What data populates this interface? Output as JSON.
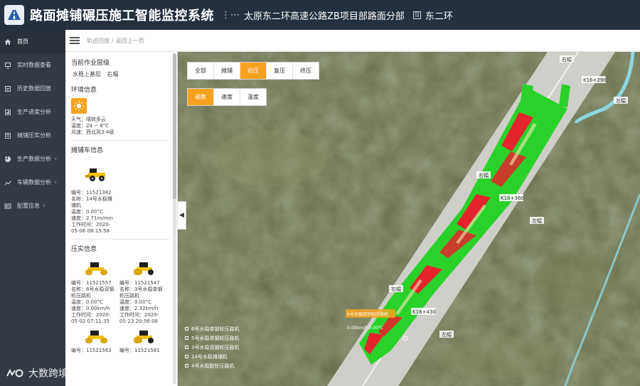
{
  "header": {
    "title": "路面摊铺碾压施工智能监控系统",
    "project": "太原东二环高速公路ZB项目部路面分部",
    "section": "东二环",
    "section_icon": "目"
  },
  "sidebar": {
    "items": [
      {
        "label": "首页",
        "icon": "home-icon"
      },
      {
        "label": "实时数据查看",
        "icon": "monitor-icon"
      },
      {
        "label": "历史数据回放",
        "icon": "history-icon"
      },
      {
        "label": "生产进度分析",
        "icon": "progress-icon"
      },
      {
        "label": "摊铺压实分析",
        "icon": "analysis-icon"
      },
      {
        "label": "生产数据分析",
        "icon": "pie-icon",
        "caret": "∨"
      },
      {
        "label": "车辆数据分析",
        "icon": "chart-icon",
        "caret": "∨"
      },
      {
        "label": "配置信息",
        "icon": "config-icon",
        "caret": "∨"
      }
    ]
  },
  "breadcrumb": {
    "first": "轨迹回放",
    "separator": "/",
    "second": "返回上一页"
  },
  "panel": {
    "layer": {
      "title": "当前作业层级",
      "name": "水稳上基层",
      "side": "右幅"
    },
    "env": {
      "title": "环境信息",
      "weather": "天气：晴转多云",
      "temperature": "温度：24 ~ 8°C",
      "wind": "风速：西北风3-4级"
    },
    "paver": {
      "title": "摊铺车信息",
      "lines": [
        "编号：11521382",
        "名称：14号水稳摊",
        "铺机",
        "温度：0.00°C",
        "速度：2.71m/min",
        "工作时间：2020-",
        "05-06 08:15:58"
      ]
    },
    "rollers": {
      "title": "压实信息",
      "items": [
        {
          "lines": [
            "编号：11521557",
            "名称：6号水稳双钢",
            "轮压路机",
            "温度：0.00°C",
            "速度：0.00km/h",
            "工作时间：2020-",
            "05-02 07:11:35"
          ]
        },
        {
          "lines": [
            "编号：11521547",
            "名称：3号水稳单钢",
            "轮压路机",
            "温度：0.00°C",
            "速度：2.32km/h",
            "工作时间：2020-",
            "05-23 20:56:08"
          ]
        },
        {
          "lines": [
            "编号：11521563"
          ]
        },
        {
          "lines": [
            "编号：11521581"
          ]
        }
      ]
    }
  },
  "map": {
    "mode_tabs": [
      "全部",
      "摊铺",
      "初压",
      "复压",
      "终压"
    ],
    "active_mode": 2,
    "metric_tabs": [
      "遍数",
      "速度",
      "温度"
    ],
    "active_metric": 0,
    "labels": {
      "stake1": "K16+290",
      "stake2": "K16+360",
      "stake3": "K16+430",
      "right": "右幅",
      "left": "左幅",
      "rl_top": "右幅",
      "ll_top": "左幅",
      "rl_mid": "右幅",
      "ll_mid": "左幅",
      "rl_low": "右幅",
      "ll_low": "左幅"
    },
    "machine_popup": {
      "name": "6号水稳双钢轮压路机",
      "speed": "0.00km/h 0.00°C"
    },
    "legend": [
      "6号水稳单钢轮压路机",
      "5号水稳单钢轮压路机",
      "3号水稳双钢轮压路机",
      "14号水稳摊铺机",
      "4号水稳胶轮压路机"
    ]
  },
  "watermark": "大数跨境",
  "colors": {
    "accent": "#f6a21e",
    "header_bg": "#25303f",
    "sidebar_bg": "#333a44",
    "paved": "#2bd12b",
    "hot": "#e3252b"
  }
}
